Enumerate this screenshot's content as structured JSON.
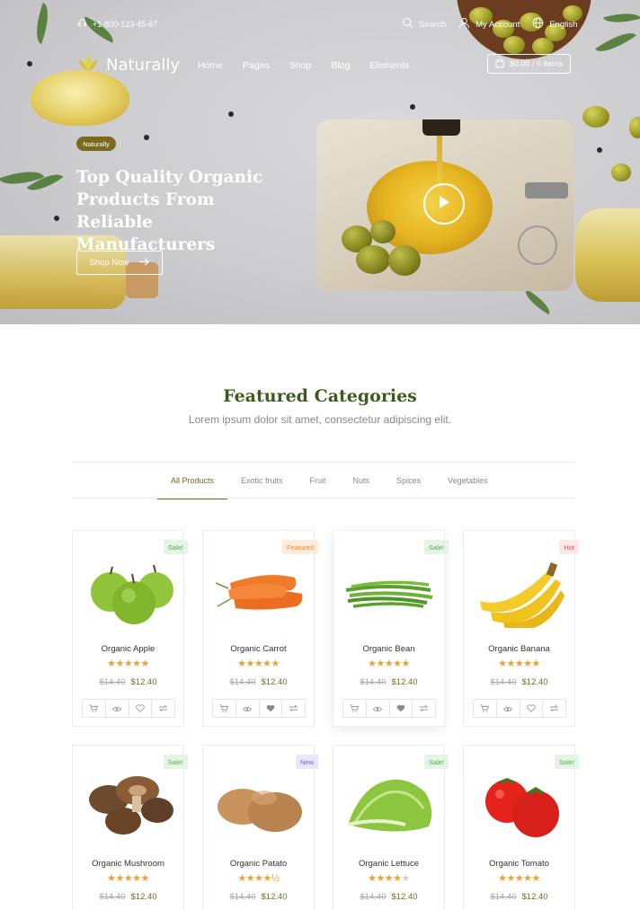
{
  "topbar": {
    "phone": "+1-800-123-45-67",
    "search_label": "Search",
    "account_label": "My Account",
    "language_label": "English"
  },
  "header": {
    "logo_text": "Naturally",
    "nav": [
      "Home",
      "Pages",
      "Shop",
      "Blog",
      "Elements"
    ],
    "cart_label": "$0.00 / 0 items"
  },
  "hero": {
    "badge": "Naturally",
    "title": "Top Quality Organic Products From Reliable Manufacturers",
    "cta": "Shop Now"
  },
  "featured": {
    "title": "Featured Categories",
    "subtitle": "Lorem ipsum dolor sit amet, consectetur adipiscing elit.",
    "tabs": [
      "All Products",
      "Exotic fruits",
      "Fruit",
      "Nuts",
      "Spices",
      "Vegetables"
    ],
    "active_tab": "All Products"
  },
  "products": [
    {
      "name": "Organic Apple",
      "badge": "Sale!",
      "stars": "★★★★★",
      "old_price": "$14.40",
      "price": "$12.40"
    },
    {
      "name": "Organic Carrot",
      "badge": "Featured",
      "stars": "★★★★★",
      "old_price": "$14.40",
      "price": "$12.40"
    },
    {
      "name": "Organic Bean",
      "badge": "Sale!",
      "stars": "★★★★★",
      "old_price": "$14.40",
      "price": "$12.40"
    },
    {
      "name": "Organic Banana",
      "badge": "Hot",
      "stars": "★★★★★",
      "old_price": "$14.40",
      "price": "$12.40"
    },
    {
      "name": "Organic Mushroom",
      "badge": "Sale!",
      "stars": "★★★★★",
      "old_price": "$14.40",
      "price": "$12.40"
    },
    {
      "name": "Organic Patato",
      "badge": "New",
      "stars": "★★★★½",
      "old_price": "$14.40",
      "price": "$12.40"
    },
    {
      "name": "Organic Lettuce",
      "badge": "Sale!",
      "stars": "★★★★",
      "stars_empty": "★",
      "old_price": "$14.40",
      "price": "$12.40"
    },
    {
      "name": "Organic Tomato",
      "badge": "Sale!",
      "stars": "★★★★★",
      "old_price": "$14.40",
      "price": "$12.40"
    }
  ],
  "colors": {
    "brand_green": "#3e5a1f",
    "accent_olive": "#7a6a1f",
    "star": "#e6a23c"
  }
}
